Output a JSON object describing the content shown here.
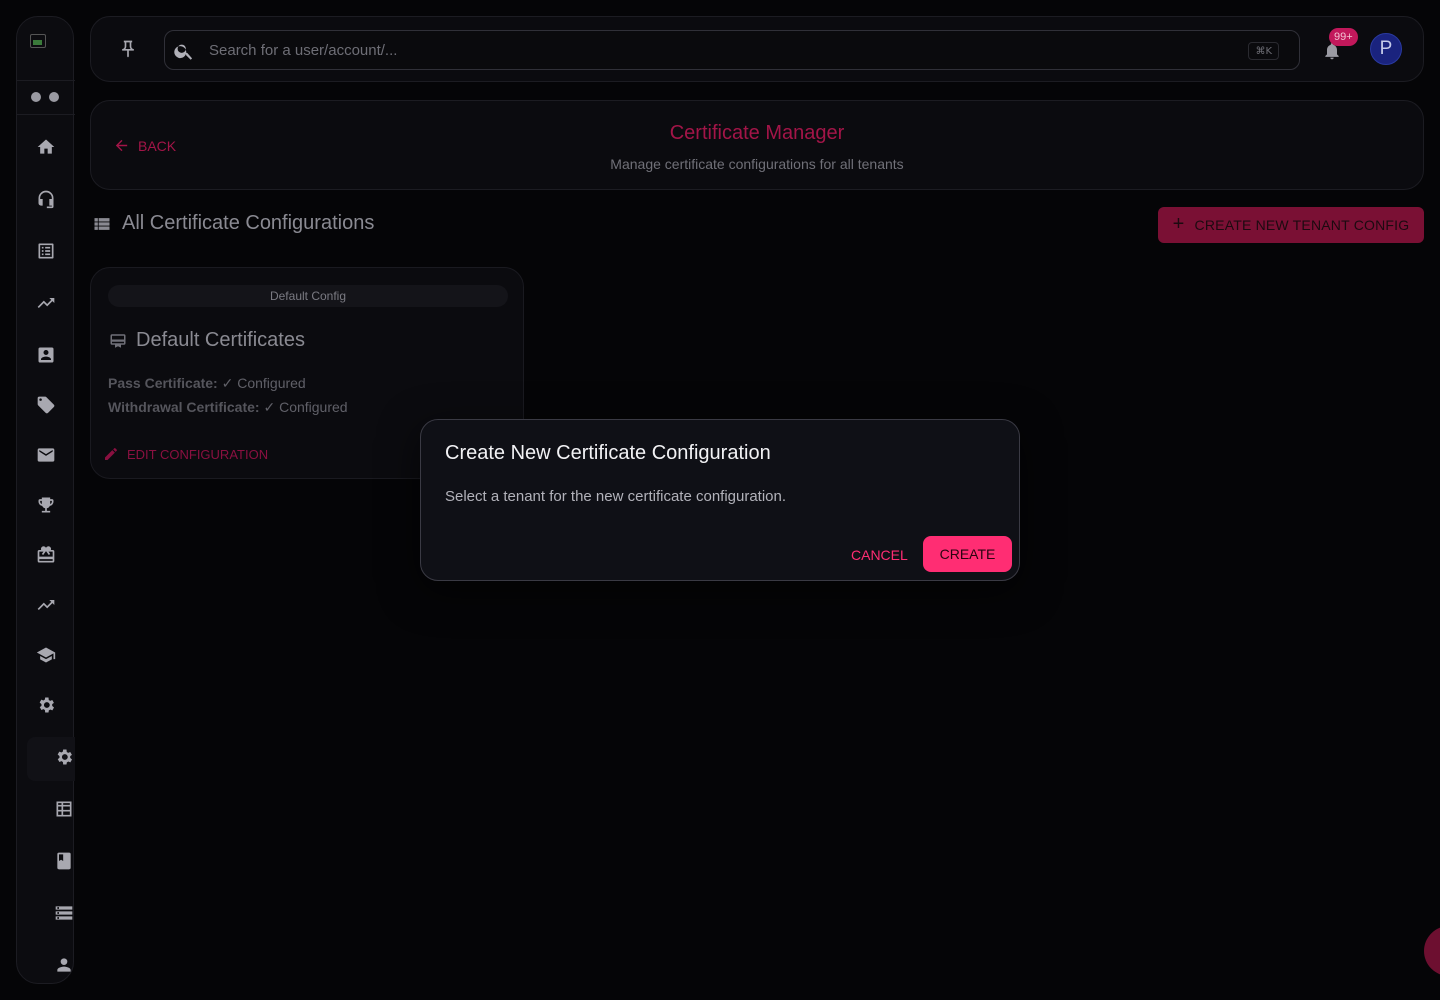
{
  "topbar": {
    "search_placeholder": "Search for a user/account/...",
    "shortcut": "⌘K",
    "notification_count": "99+",
    "avatar_initial": "P"
  },
  "header": {
    "back_label": "BACK",
    "title": "Certificate Manager",
    "subtitle": "Manage certificate configurations for all tenants"
  },
  "section": {
    "title": "All Certificate Configurations",
    "create_button": "CREATE NEW TENANT CONFIG"
  },
  "config_card": {
    "chip": "Default Config",
    "title": "Default Certificates",
    "rows": [
      {
        "label": "Pass Certificate:",
        "value": "✓ Configured"
      },
      {
        "label": "Withdrawal Certificate:",
        "value": "✓ Configured"
      }
    ],
    "edit_label": "EDIT CONFIGURATION"
  },
  "modal": {
    "title": "Create New Certificate Configuration",
    "text": "Select a tenant for the new certificate configuration.",
    "cancel_label": "CANCEL",
    "create_label": "CREATE"
  },
  "colors": {
    "accent": "#ff2d73",
    "accent_dim": "#a31548",
    "background": "#050507"
  }
}
